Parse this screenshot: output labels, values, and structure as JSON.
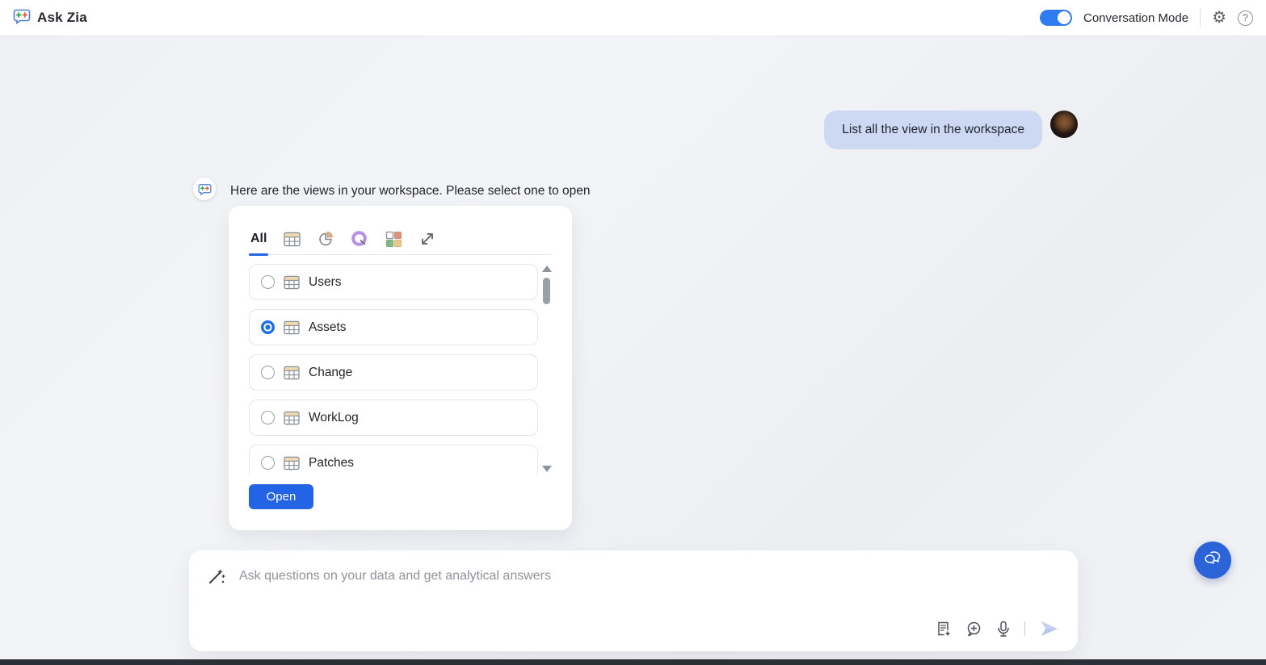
{
  "header": {
    "app_title": "Ask Zia",
    "conversation_mode": {
      "label": "Conversation Mode",
      "on": true
    }
  },
  "chat": {
    "user_message": "List all the view in the workspace",
    "zia_message": "Here are the views in your workspace. Please select one to open"
  },
  "view_picker": {
    "tabs": [
      {
        "label": "All",
        "selected": true
      },
      {
        "icon": "table-view-icon"
      },
      {
        "icon": "chart-view-icon"
      },
      {
        "icon": "query-table-icon"
      },
      {
        "icon": "dashboard-view-icon"
      },
      {
        "icon": "related-view-icon"
      }
    ],
    "items": [
      {
        "label": "Users",
        "selected": false
      },
      {
        "label": "Assets",
        "selected": true
      },
      {
        "label": "Change",
        "selected": false
      },
      {
        "label": "WorkLog",
        "selected": false
      },
      {
        "label": "Patches",
        "selected": false
      }
    ],
    "open_button_label": "Open"
  },
  "composer": {
    "placeholder": "Ask questions on your data and get analytical answers",
    "icons": [
      "magic-wand-icon",
      "add-note-icon",
      "add-query-icon",
      "microphone-icon",
      "send-icon"
    ]
  },
  "colors": {
    "accent_blue": "#2264e5",
    "toggle_blue": "#2e7cf0",
    "user_bubble": "#cdd9f2",
    "fab_blue": "#2b63d9",
    "table_icon_header": "#eed9ae",
    "query_icon_purple": "#b791e8"
  }
}
